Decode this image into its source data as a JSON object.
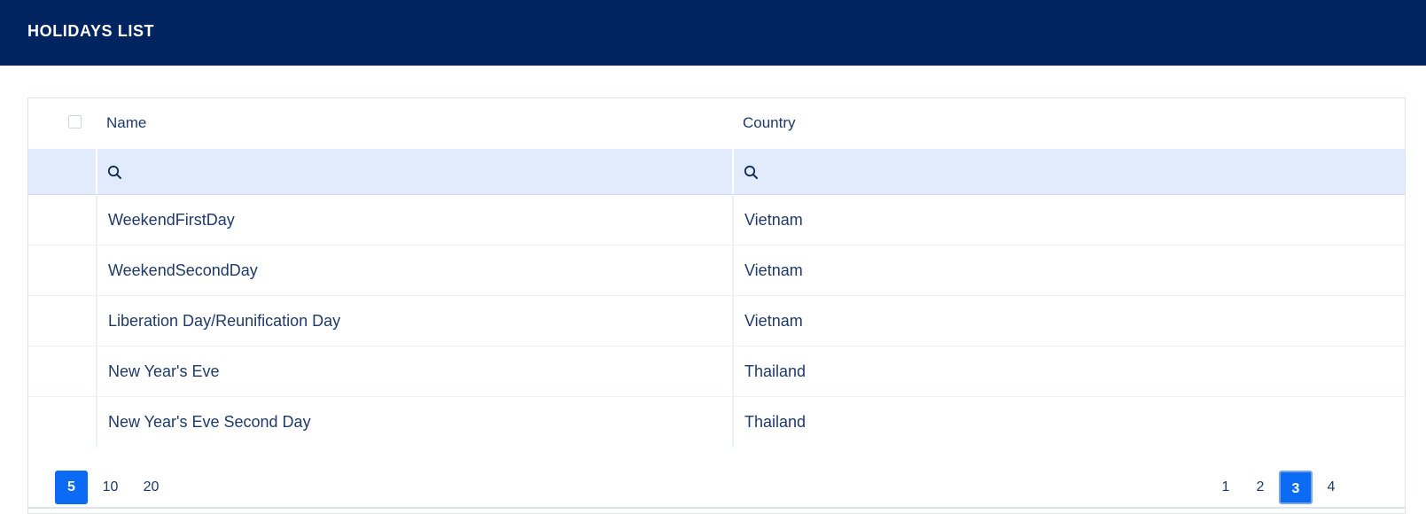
{
  "header": {
    "title": "HOLIDAYS LIST",
    "background_color": "#00245f"
  },
  "table": {
    "columns": [
      "Name",
      "Country"
    ],
    "filter_icon": "search-icon",
    "rows": [
      {
        "name": "WeekendFirstDay",
        "country": "Vietnam"
      },
      {
        "name": "WeekendSecondDay",
        "country": "Vietnam"
      },
      {
        "name": "Liberation Day/Reunification Day",
        "country": "Vietnam"
      },
      {
        "name": "New Year's Eve",
        "country": "Thailand"
      },
      {
        "name": "New Year's Eve Second Day",
        "country": "Thailand"
      }
    ]
  },
  "pager": {
    "page_sizes": [
      "5",
      "10",
      "20"
    ],
    "selected_page_size": "5",
    "pages": [
      "1",
      "2",
      "3",
      "4"
    ],
    "current_page": "3",
    "accent_color": "#0b6bf5"
  }
}
